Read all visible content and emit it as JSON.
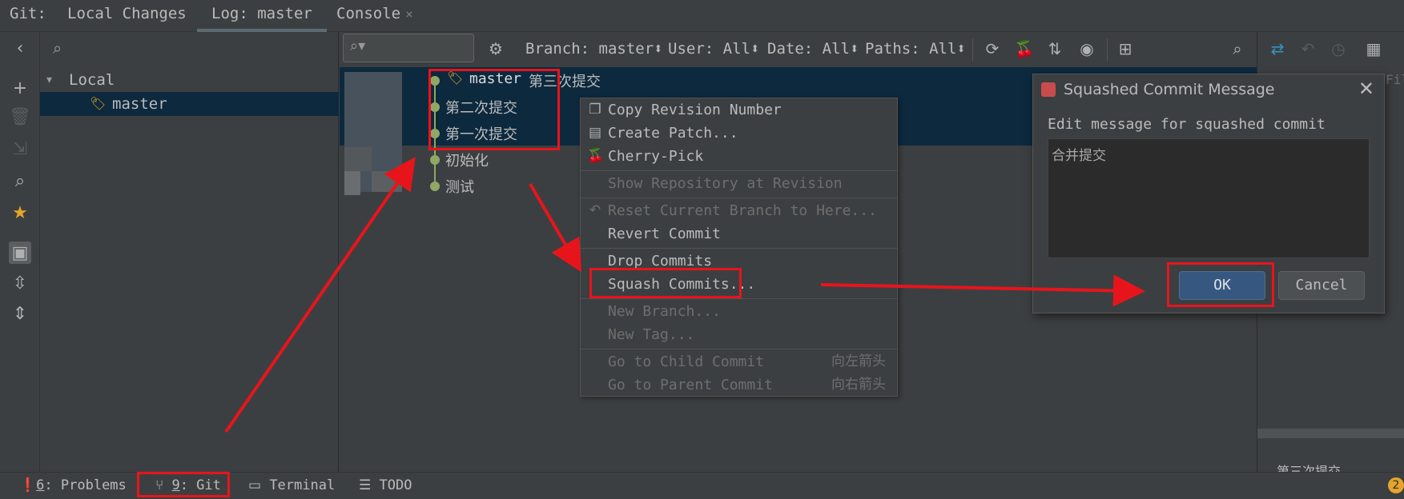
{
  "tabs": {
    "prefix": "Git:",
    "local_changes": "Local Changes",
    "log": "Log: master",
    "console": "Console",
    "close_glyph": "×"
  },
  "branches": {
    "local_label": "Local",
    "master_label": "master"
  },
  "log_toolbar": {
    "branch_filter": "Branch: master",
    "user_filter": "User: All",
    "date_filter": "Date: All",
    "paths_filter": "Paths: All"
  },
  "commits": [
    {
      "tag": "master",
      "message": "第三次提交"
    },
    {
      "tag": "",
      "message": "第二次提交"
    },
    {
      "tag": "",
      "message": "第一次提交"
    },
    {
      "tag": "",
      "message": "初始化"
    },
    {
      "tag": "",
      "message": "测试"
    }
  ],
  "context_menu": {
    "copy_revision": "Copy Revision Number",
    "create_patch": "Create Patch...",
    "cherry_pick": "Cherry-Pick",
    "show_repo": "Show Repository at Revision",
    "reset_branch": "Reset Current Branch to Here...",
    "revert_commit": "Revert Commit",
    "drop_commits": "Drop Commits",
    "squash_commits": "Squash Commits...",
    "new_branch": "New Branch...",
    "new_tag": "New Tag...",
    "go_child": "Go to Child Commit",
    "go_child_shortcut": "向左箭头",
    "go_parent": "Go to Parent Commit",
    "go_parent_shortcut": "向右箭头"
  },
  "dialog": {
    "title": "Squashed Commit Message",
    "prompt": "Edit message for squashed commit",
    "message": "合并提交",
    "ok_label": "OK",
    "cancel_label": "Cancel"
  },
  "details_panel": {
    "clipped_top": "Fil",
    "clipped_bottom": "第三次提交"
  },
  "status_bar": {
    "problems_num": "6",
    "problems_label": ": Problems",
    "git_num": "9",
    "git_label": ": Git",
    "terminal_label": "Terminal",
    "todo_label": "TODO",
    "notification_count": "2"
  },
  "colors": {
    "background": "#3c3f41",
    "selection": "#0d293e",
    "graph": "#8fa865",
    "annotation": "#e8141c",
    "ok_button": "#365880"
  }
}
